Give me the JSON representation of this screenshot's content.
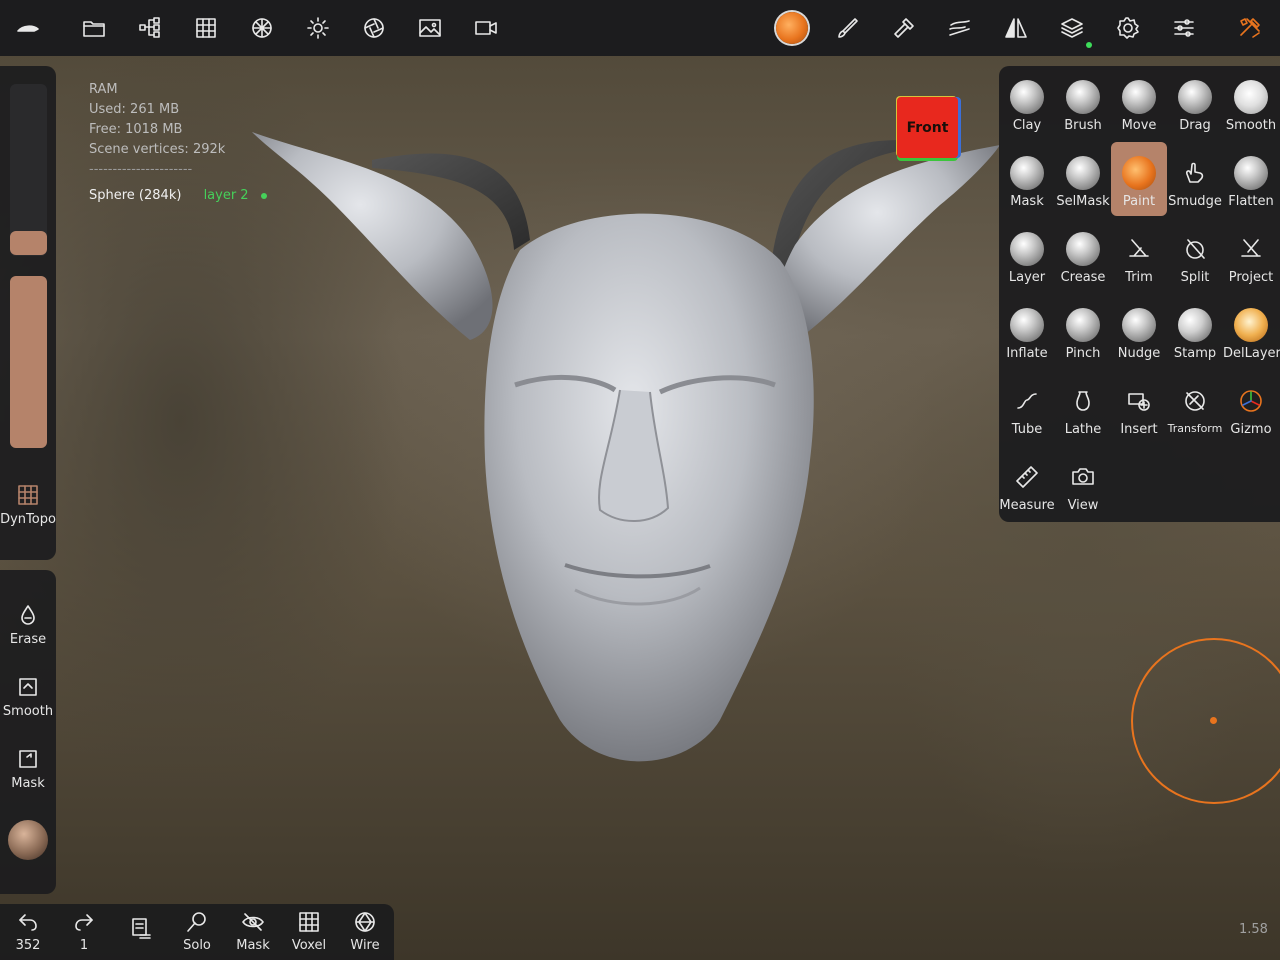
{
  "stats": {
    "ram_title": "RAM",
    "used": "Used: 261 MB",
    "free": "Free: 1018 MB",
    "vertices": "Scene vertices: 292k",
    "separator": "----------------------",
    "object": "Sphere (284k)",
    "layer": "layer 2"
  },
  "view_cube": {
    "label": "Front"
  },
  "left_panel": {
    "dyntopo": "DynTopo",
    "erase": "Erase",
    "smooth": "Smooth",
    "mask": "Mask"
  },
  "bottom_bar": {
    "undo_count": "352",
    "redo_count": "1",
    "solo": "Solo",
    "mask": "Mask",
    "voxel": "Voxel",
    "wire": "Wire"
  },
  "tools": [
    {
      "label": "Clay"
    },
    {
      "label": "Brush"
    },
    {
      "label": "Move"
    },
    {
      "label": "Drag"
    },
    {
      "label": "Smooth"
    },
    {
      "label": "Mask"
    },
    {
      "label": "SelMask"
    },
    {
      "label": "Paint"
    },
    {
      "label": "Smudge"
    },
    {
      "label": "Flatten"
    },
    {
      "label": "Layer"
    },
    {
      "label": "Crease"
    },
    {
      "label": "Trim"
    },
    {
      "label": "Split"
    },
    {
      "label": "Project"
    },
    {
      "label": "Inflate"
    },
    {
      "label": "Pinch"
    },
    {
      "label": "Nudge"
    },
    {
      "label": "Stamp"
    },
    {
      "label": "DelLayer"
    },
    {
      "label": "Tube"
    },
    {
      "label": "Lathe"
    },
    {
      "label": "Insert"
    },
    {
      "label": "Transform"
    },
    {
      "label": "Gizmo"
    },
    {
      "label": "Measure"
    },
    {
      "label": "View"
    }
  ],
  "active_tool": "Paint",
  "zoom_readout": "1.58",
  "colors": {
    "accent": "#e8741e",
    "active_tool_bg": "#b5836a",
    "layer_green": "#46d05a",
    "panel_bg": "#1c1c1e"
  }
}
